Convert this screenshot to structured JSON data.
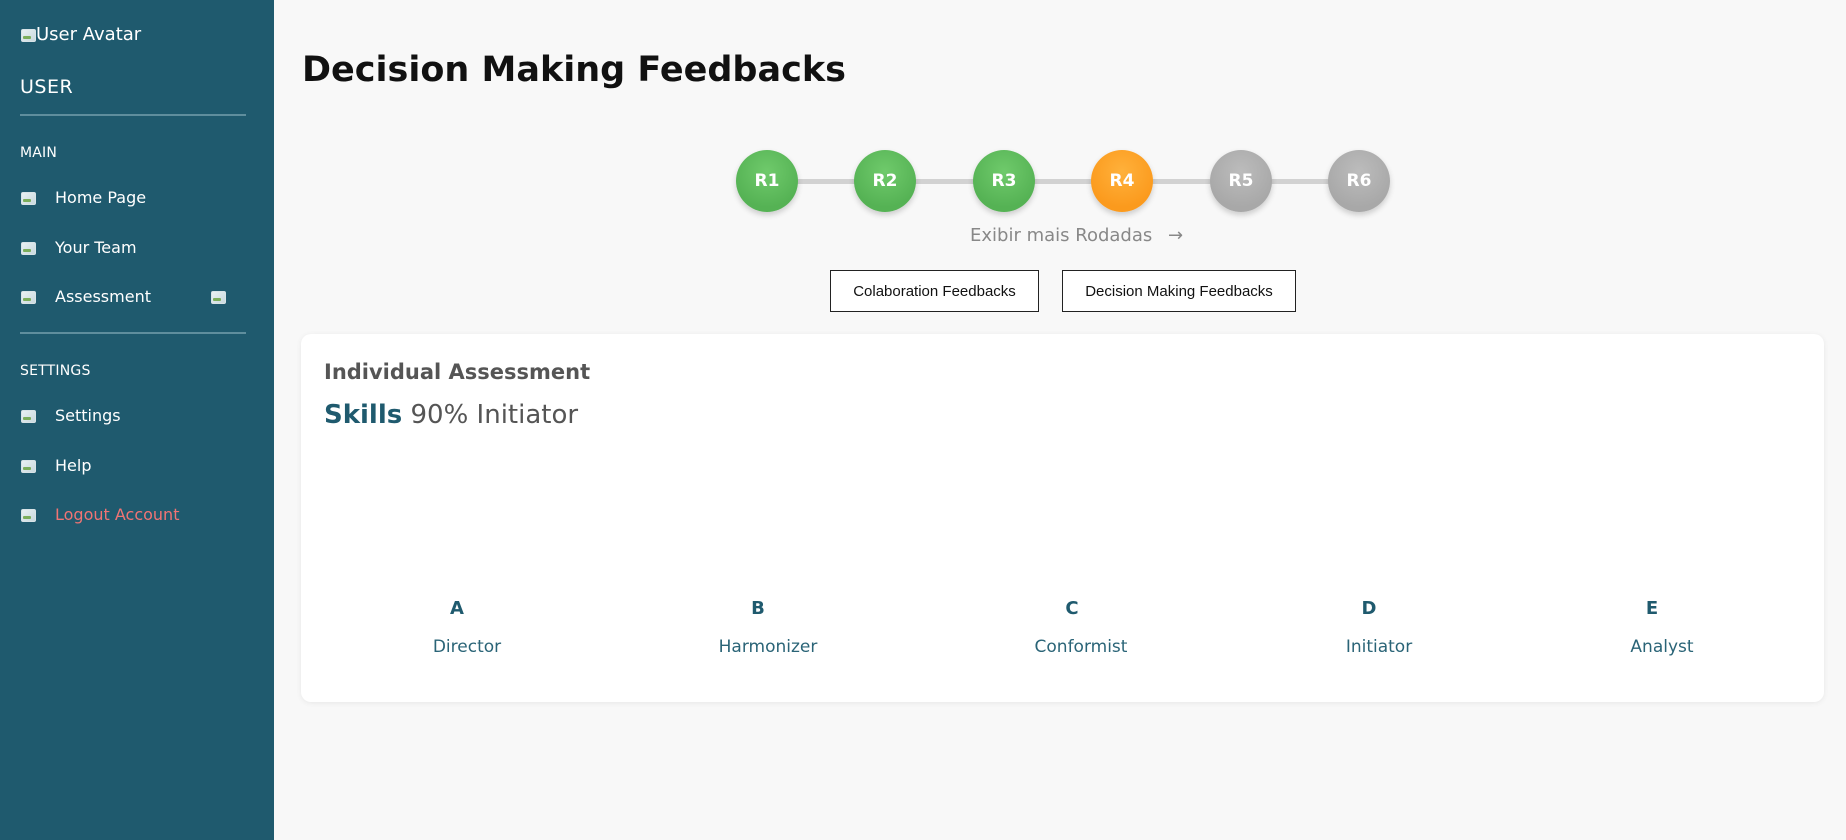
{
  "sidebar": {
    "avatar_alt": "User Avatar",
    "user_label": "USER",
    "main_section": "MAIN",
    "settings_section": "SETTINGS",
    "items": [
      {
        "label": "Home Page",
        "icon": "home-icon"
      },
      {
        "label": "Your Team",
        "icon": "team-icon"
      },
      {
        "label": "Assessment",
        "icon": "assessment-icon"
      },
      {
        "label": "Settings",
        "icon": "settings-icon"
      },
      {
        "label": "Help",
        "icon": "help-icon"
      },
      {
        "label": "Logout Account",
        "icon": "logout-icon"
      }
    ],
    "colors": {
      "background": "#1f5a6e",
      "logout": "#f07474"
    }
  },
  "page": {
    "title": "Decision Making Feedbacks"
  },
  "rounds": {
    "items": [
      {
        "label": "R1",
        "status": "completed"
      },
      {
        "label": "R2",
        "status": "completed"
      },
      {
        "label": "R3",
        "status": "completed"
      },
      {
        "label": "R4",
        "status": "current"
      },
      {
        "label": "R5",
        "status": "locked"
      },
      {
        "label": "R6",
        "status": "locked"
      }
    ],
    "more_label": "Exibir mais Rodadas",
    "more_arrow": "→",
    "colors": {
      "completed": "#5cb85c",
      "current": "#fb9a1d",
      "locked": "#aaaaaa"
    }
  },
  "tabs": {
    "collaboration": "Colaboration Feedbacks",
    "decision": "Decision Making Feedbacks"
  },
  "assessment": {
    "title": "Individual Assessment",
    "skills_label": "Skills",
    "skills_value": "90% Initiator",
    "profiles": [
      {
        "letter": "A",
        "name": "Director"
      },
      {
        "letter": "B",
        "name": "Harmonizer"
      },
      {
        "letter": "C",
        "name": "Conformist"
      },
      {
        "letter": "D",
        "name": "Initiator"
      },
      {
        "letter": "E",
        "name": "Analyst"
      }
    ]
  }
}
